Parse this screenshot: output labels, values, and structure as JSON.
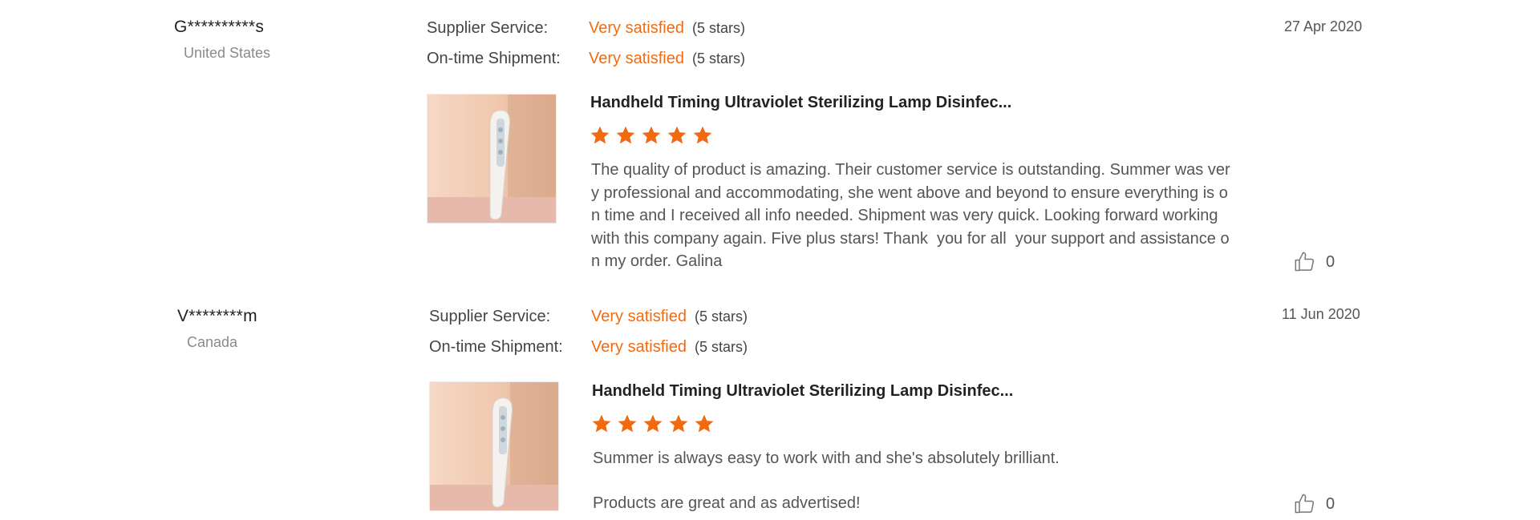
{
  "reviews": [
    {
      "buyer": "G**********s",
      "country": "United States",
      "date": "27 Apr 2020",
      "ratings": [
        {
          "label": "Supplier Service:",
          "text": "Very satisfied",
          "stars": "(5 stars)"
        },
        {
          "label": "On-time Shipment:",
          "text": "Very satisfied",
          "stars": "(5 stars)"
        }
      ],
      "product_title": "Handheld Timing Ultraviolet Sterilizing Lamp Disinfec...",
      "star_rating": 5,
      "text": "The quality of product is amazing. Their customer service is outstanding. Summer was very professional and accommodating, she went above and beyond to ensure everything is on time and I received all info needed. Shipment was very quick. Looking forward working with this company again. Five plus stars! Thank  you for all  your support and assistance on my order. Galina",
      "likes": "0"
    },
    {
      "buyer": "V********m",
      "country": "Canada",
      "date": "11 Jun 2020",
      "ratings": [
        {
          "label": "Supplier Service:",
          "text": "Very satisfied",
          "stars": "(5 stars)"
        },
        {
          "label": "On-time Shipment:",
          "text": "Very satisfied",
          "stars": "(5 stars)"
        }
      ],
      "product_title": "Handheld Timing Ultraviolet Sterilizing Lamp Disinfec...",
      "star_rating": 5,
      "text": "Summer is always easy to work with and she's absolutely brilliant.\n\nProducts are great and as advertised!",
      "likes": "0"
    }
  ],
  "colors": {
    "accent": "#f26a10",
    "star": "#f26a10",
    "muted": "#8a8a8a"
  },
  "icons": {
    "star": "star-icon",
    "like": "thumbs-up-icon"
  }
}
